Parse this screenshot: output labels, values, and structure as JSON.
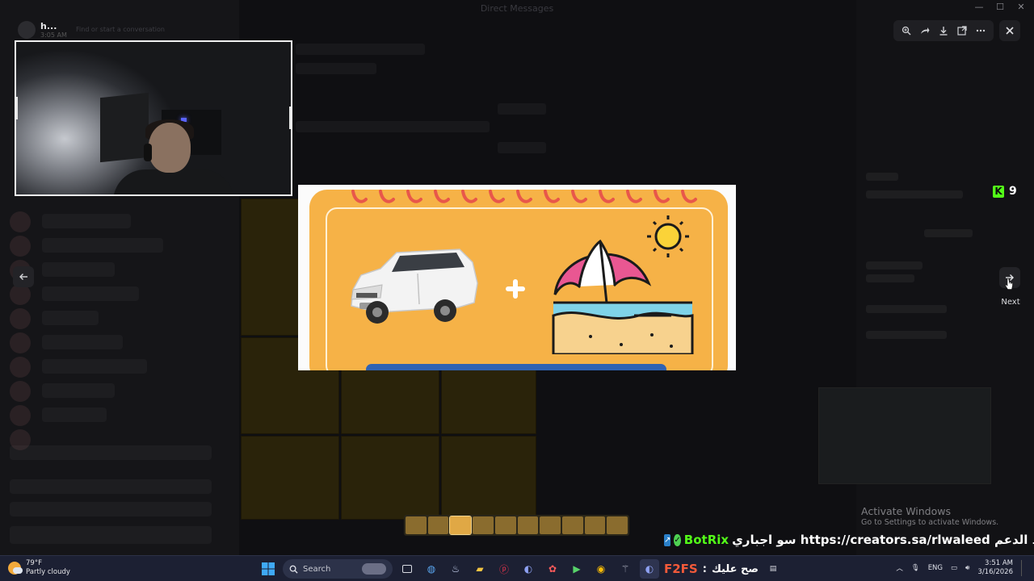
{
  "window": {
    "title": "Direct Messages"
  },
  "user_header": {
    "name": "h...",
    "time": "3:05 AM",
    "placeholder": "Find or start a conversation"
  },
  "viewer": {
    "next_label": "Next"
  },
  "kick_badge": {
    "count": "9",
    "color": "#53fc18"
  },
  "main_image": {
    "background": "#f6b247"
  },
  "watermark": {
    "title": "Activate Windows",
    "subtitle": "Go to Settings to activate Windows."
  },
  "ticker": {
    "bot_name": "BotRix",
    "message": ": رابط الدعم https://creators.sa/rlwaleed سو اجباري"
  },
  "thumbnails": {
    "count": 10,
    "active_index": 2
  },
  "taskbar": {
    "weather_temp": "79°F",
    "weather_desc": "Partly cloudy",
    "search_placeholder": "Search",
    "overlay_brand": "F2FS",
    "overlay_sep": ":",
    "overlay_text": "صح عليك",
    "language": "ENG",
    "time": "3:51 AM",
    "date": "3/16/2026"
  },
  "colors": {
    "accent_green": "#53fc18",
    "taskbar": "#1c2033",
    "image_orange": "#f6b247"
  }
}
